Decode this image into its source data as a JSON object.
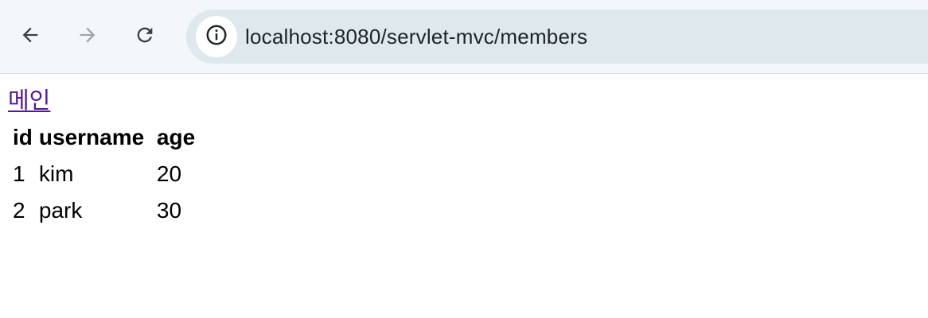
{
  "browser": {
    "back_icon": "arrow-left-icon",
    "forward_icon": "arrow-right-icon",
    "reload_icon": "reload-icon",
    "site_info_icon": "info-icon",
    "url": "localhost:8080/servlet-mvc/members"
  },
  "page": {
    "home_link": "메인",
    "table": {
      "headers": {
        "id": "id",
        "username": "username",
        "age": "age"
      },
      "rows": [
        {
          "id": "1",
          "username": "kim",
          "age": "20"
        },
        {
          "id": "2",
          "username": "park",
          "age": "30"
        }
      ]
    }
  },
  "colors": {
    "link_visited": "#551a8b",
    "toolbar_bg": "#f4f7f9",
    "omnibox_bg": "#dfe8ec"
  }
}
